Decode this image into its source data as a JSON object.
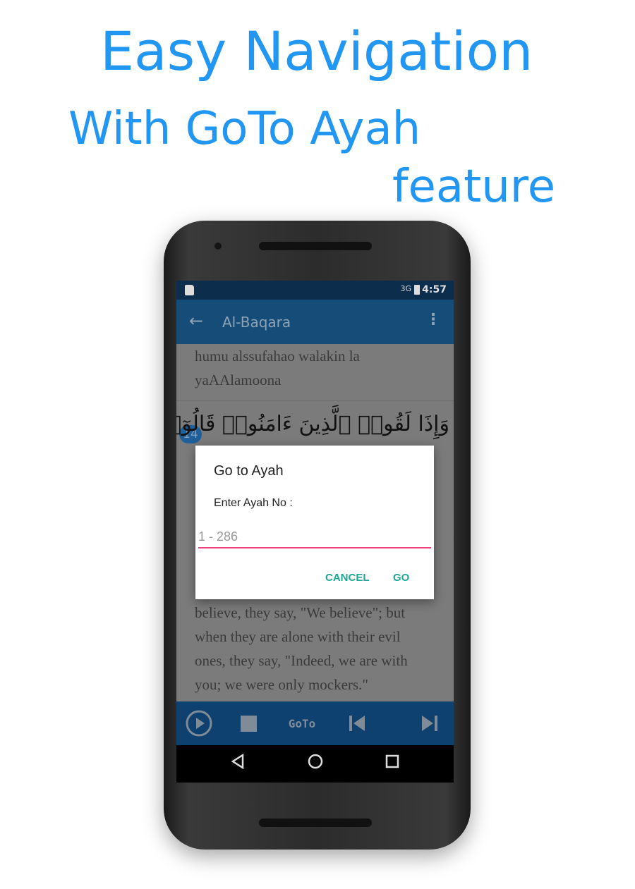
{
  "headline": {
    "line1": "Easy Navigation",
    "line2": "With GoTo Ayah",
    "line3": "feature"
  },
  "status_bar": {
    "time": "4:57",
    "network": "3G",
    "icons": [
      "sd-card-icon",
      "signal-icon",
      "battery-icon"
    ]
  },
  "toolbar": {
    "title": "Al-Baqara",
    "back_icon": "arrow-left-icon",
    "menu_icon": "more-vert-icon"
  },
  "content": {
    "transliteration": [
      "humu alssufahao walakin la",
      "yaAAlamoona"
    ],
    "ayah_number": "14",
    "arabic": "وَإِذَا لَقُوا۟ ٱلَّذِينَ ءَامَنُوا۟ قَالُوٓا۟",
    "translation": [
      "believe, they say, \"We believe\"; but",
      "when they are alone with their evil",
      "ones, they say, \"Indeed, we are with",
      "you; we were only mockers.\""
    ]
  },
  "dialog": {
    "title": "Go to Ayah",
    "label": "Enter Ayah No :",
    "placeholder": "1 - 286",
    "cancel": "CANCEL",
    "go": "GO",
    "accent": "#1ea893",
    "underline": "#f0437c"
  },
  "player": {
    "goto_label": "GoTo",
    "icons": [
      "play-icon",
      "stop-icon",
      "skip-previous-icon",
      "skip-next-icon"
    ]
  },
  "nav_bar": {
    "icons": [
      "back-triangle-icon",
      "home-circle-icon",
      "recents-square-icon"
    ]
  },
  "colors": {
    "headline": "#2196f3",
    "toolbar": "#164c78",
    "bottom_bar": "#0e4170"
  }
}
